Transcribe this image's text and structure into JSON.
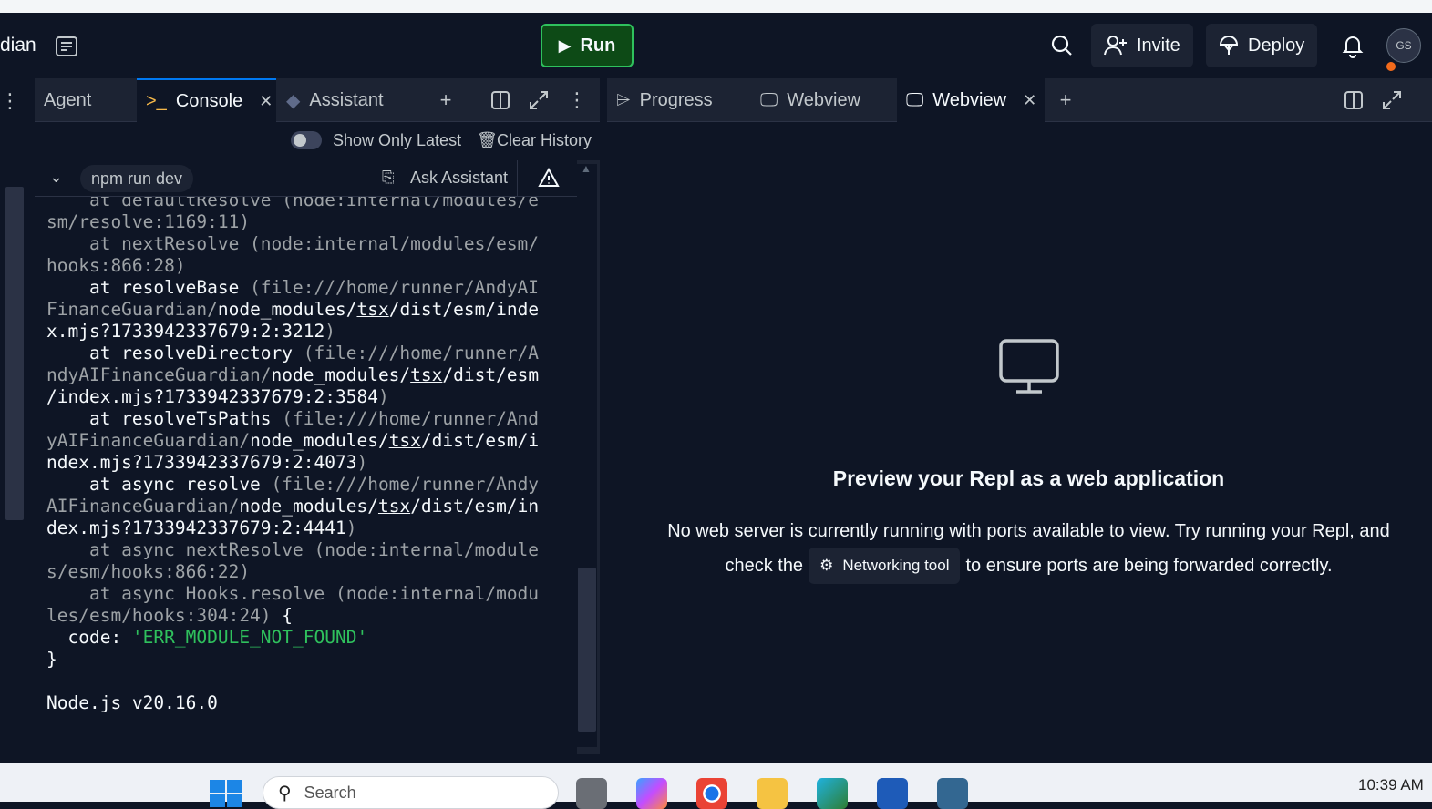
{
  "header": {
    "title_fragment": "dian",
    "run_label": "Run",
    "invite_label": "Invite",
    "deploy_label": "Deploy",
    "avatar_initials": "GS"
  },
  "left_tabs": {
    "agent": "Agent",
    "console": "Console",
    "assistant": "Assistant"
  },
  "console_toolbar": {
    "show_only_latest": "Show Only Latest",
    "clear_history": "Clear History"
  },
  "command": {
    "name": "npm run dev",
    "ask_assistant": "Ask Assistant"
  },
  "console_lines": [
    {
      "segments": [
        {
          "t": "    at defaultResolve (node:internal/modules/e",
          "c": "dim"
        }
      ]
    },
    {
      "segments": [
        {
          "t": "sm/resolve:1169:11)",
          "c": "dim"
        }
      ]
    },
    {
      "segments": [
        {
          "t": "    at nextResolve (node:internal/modules/esm/",
          "c": "dim"
        }
      ]
    },
    {
      "segments": [
        {
          "t": "hooks:866:28)",
          "c": "dim"
        }
      ]
    },
    {
      "segments": [
        {
          "t": "    at resolveBase ",
          "c": ""
        },
        {
          "t": "(file:///home/runner/AndyAI",
          "c": "dim"
        }
      ]
    },
    {
      "segments": [
        {
          "t": "FinanceGuardian/",
          "c": "dim"
        },
        {
          "t": "node_modules/",
          "c": ""
        },
        {
          "t": "tsx",
          "c": "ul"
        },
        {
          "t": "/dist/esm/inde",
          "c": ""
        }
      ]
    },
    {
      "segments": [
        {
          "t": "x.mjs?1733942337679:2:3212",
          "c": ""
        },
        {
          "t": ")",
          "c": "dim"
        }
      ]
    },
    {
      "segments": [
        {
          "t": "    at resolveDirectory ",
          "c": ""
        },
        {
          "t": "(file:///home/runner/A",
          "c": "dim"
        }
      ]
    },
    {
      "segments": [
        {
          "t": "ndyAIFinanceGuardian/",
          "c": "dim"
        },
        {
          "t": "node_modules/",
          "c": ""
        },
        {
          "t": "tsx",
          "c": "ul"
        },
        {
          "t": "/dist/esm",
          "c": ""
        }
      ]
    },
    {
      "segments": [
        {
          "t": "/index.mjs?1733942337679:2:3584",
          "c": ""
        },
        {
          "t": ")",
          "c": "dim"
        }
      ]
    },
    {
      "segments": [
        {
          "t": "    at resolveTsPaths ",
          "c": ""
        },
        {
          "t": "(file:///home/runner/And",
          "c": "dim"
        }
      ]
    },
    {
      "segments": [
        {
          "t": "yAIFinanceGuardian/",
          "c": "dim"
        },
        {
          "t": "node_modules/",
          "c": ""
        },
        {
          "t": "tsx",
          "c": "ul"
        },
        {
          "t": "/dist/esm/i",
          "c": ""
        }
      ]
    },
    {
      "segments": [
        {
          "t": "ndex.mjs?1733942337679:2:4073",
          "c": ""
        },
        {
          "t": ")",
          "c": "dim"
        }
      ]
    },
    {
      "segments": [
        {
          "t": "    at async resolve ",
          "c": ""
        },
        {
          "t": "(file:///home/runner/Andy",
          "c": "dim"
        }
      ]
    },
    {
      "segments": [
        {
          "t": "AIFinanceGuardian/",
          "c": "dim"
        },
        {
          "t": "node_modules/",
          "c": ""
        },
        {
          "t": "tsx",
          "c": "ul"
        },
        {
          "t": "/dist/esm/in",
          "c": ""
        }
      ]
    },
    {
      "segments": [
        {
          "t": "dex.mjs?1733942337679:2:4441",
          "c": ""
        },
        {
          "t": ")",
          "c": "dim"
        }
      ]
    },
    {
      "segments": [
        {
          "t": "    at async nextResolve (node:internal/module",
          "c": "dim"
        }
      ]
    },
    {
      "segments": [
        {
          "t": "s/esm/hooks:866:22)",
          "c": "dim"
        }
      ]
    },
    {
      "segments": [
        {
          "t": "    at async Hooks.resolve (node:internal/modu",
          "c": "dim"
        }
      ]
    },
    {
      "segments": [
        {
          "t": "les/esm/hooks:304:24) ",
          "c": "dim"
        },
        {
          "t": "{",
          "c": ""
        }
      ]
    },
    {
      "segments": [
        {
          "t": "  code: ",
          "c": ""
        },
        {
          "t": "'ERR_MODULE_NOT_FOUND'",
          "c": "str"
        }
      ]
    },
    {
      "segments": [
        {
          "t": "}",
          "c": ""
        }
      ]
    },
    {
      "segments": [
        {
          "t": "",
          "c": ""
        }
      ]
    },
    {
      "segments": [
        {
          "t": "Node.js v20.16.0",
          "c": ""
        }
      ]
    }
  ],
  "right_tabs": {
    "progress": "Progress",
    "webview1": "Webview",
    "webview2": "Webview"
  },
  "preview": {
    "title": "Preview your Repl as a web application",
    "line1": "No web server is currently running with ports available to view. Try running your Repl, and",
    "line2_pre": "check the",
    "networking_tool": "Networking tool",
    "line2_post": "to ensure ports are being forwarded correctly."
  },
  "taskbar": {
    "search_placeholder": "Search",
    "clock": "10:39 AM"
  },
  "colors": {
    "bg": "#0e1525",
    "panel": "#1c2333",
    "accent_green": "#2fc15d",
    "active_tab_blue": "#0079f2",
    "dim_text": "#9da2a6"
  }
}
